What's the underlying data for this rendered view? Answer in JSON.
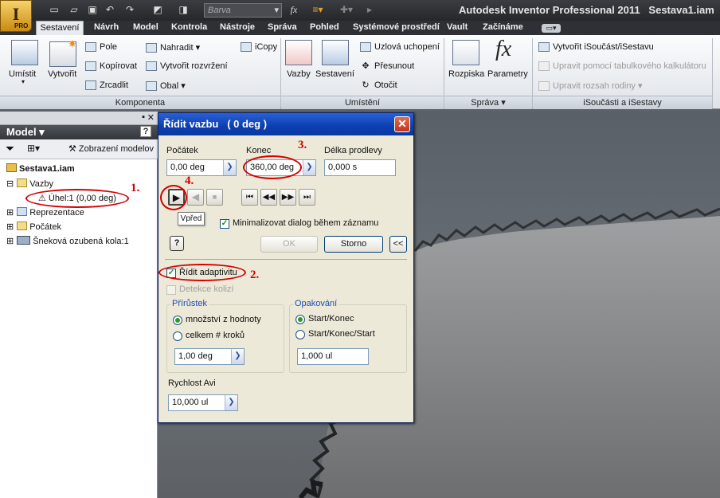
{
  "app": {
    "title": "Autodesk Inventor Professional 2011",
    "document": "Sestava1.iam",
    "logo": "I",
    "edition": "PRO",
    "color_field": "Barva"
  },
  "tabs": [
    "Sestavení",
    "Návrh",
    "Model",
    "Kontrola",
    "Nástroje",
    "Správa",
    "Pohled",
    "Systémové prostředí",
    "Vault",
    "Začínáme"
  ],
  "ribbon": {
    "komponenta": {
      "title": "Komponenta",
      "umistit": "Umístit",
      "vytvorit": "Vytvořit",
      "pole": "Pole",
      "kopirovat": "Kopírovat",
      "zrcadlit": "Zrcadlit",
      "nahradit": "Nahradit",
      "vytvorit_rozvrzeni": "Vytvořit rozvržení",
      "obal": "Obal",
      "icopy": "iCopy"
    },
    "umisteni": {
      "title": "Umístění",
      "vazby": "Vazby",
      "sestaveni": "Sestavení",
      "uzlova": "Uzlová uchopení",
      "presunout": "Přesunout",
      "otocit": "Otočit"
    },
    "sprava": {
      "title": "Správa",
      "rozpiska": "Rozpiska",
      "parametry": "Parametry"
    },
    "isoucasti": {
      "title": "iSoučásti a iSestavy",
      "vytvorit": "Vytvořit iSoučást/iSestavu",
      "upravit_tab": "Upravit pomocí tabulkového kalkulátoru",
      "upravit_rozsah": "Upravit rozsah rodiny"
    }
  },
  "browser": {
    "title": "Model",
    "view_label": "Zobrazení modelov",
    "root": "Sestava1.iam",
    "vazby": "Vazby",
    "uhel": "Úhel:1 (0,00 deg)",
    "reprezentace": "Reprezentace",
    "pocatek": "Počátek",
    "snekova": "Šneková ozubená kola:1"
  },
  "dialog": {
    "title": "Řídit vazbu",
    "title_value": "( 0 deg )",
    "pocatek_label": "Počátek",
    "pocatek_value": "0,00 deg",
    "konec_label": "Konec",
    "konec_value": "360,00 deg",
    "delka_label": "Délka prodlevy",
    "delka_value": "0,000 s",
    "tooltip": "Vpřed",
    "minimalizovat": "Minimalizovat dialog během záznamu",
    "ok": "OK",
    "storno": "Storno",
    "collapse": "<<",
    "help": "?",
    "ridit_adaptivitu": "Řídit adaptivitu",
    "detekce_kolizi": "Detekce kolizí",
    "prirustek_title": "Přírůstek",
    "mnozstvi": "množství z hodnoty",
    "celkem": "celkem # kroků",
    "prirustek_value": "1,00 deg",
    "opakovani_title": "Opakování",
    "start_konec": "Start/Konec",
    "start_konec_start": "Start/Konec/Start",
    "opakovani_value": "1,000 ul",
    "rychlost_label": "Rychlost Avi",
    "rychlost_value": "10,000 ul"
  },
  "annotations": [
    "1.",
    "2.",
    "3.",
    "4."
  ]
}
